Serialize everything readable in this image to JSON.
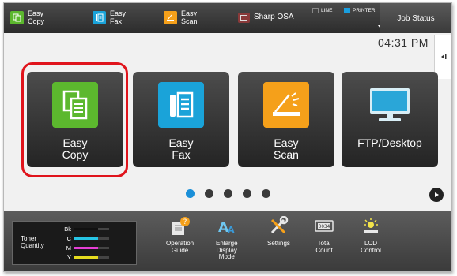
{
  "topbar": {
    "items": [
      {
        "label": "Easy\nCopy",
        "icon": "copy-icon"
      },
      {
        "label": "Easy\nFax",
        "icon": "fax-icon"
      },
      {
        "label": "Easy\nScan",
        "icon": "scan-icon"
      },
      {
        "label": "Sharp OSA",
        "icon": "osa-icon"
      }
    ],
    "indicators": {
      "line": "LINE",
      "printer": "PRINTER"
    },
    "job_status": "Job Status"
  },
  "clock": "04:31 PM",
  "tiles": [
    {
      "label": "Easy\nCopy",
      "icon": "copy-icon",
      "color": "#5cb82e"
    },
    {
      "label": "Easy\nFax",
      "icon": "fax-icon",
      "color": "#1aa3d9"
    },
    {
      "label": "Easy\nScan",
      "icon": "scan-icon",
      "color": "#f5a01a"
    },
    {
      "label": "FTP/Desktop",
      "icon": "monitor-icon",
      "color": "#2aa6d8"
    }
  ],
  "pager": {
    "pages": 5,
    "current": 1
  },
  "toner": {
    "title": "Toner\nQuantity",
    "rows": [
      {
        "label": "Bk",
        "color": "#222222"
      },
      {
        "label": "C",
        "color": "#27c6e6"
      },
      {
        "label": "M",
        "color": "#e63fd6"
      },
      {
        "label": "Y",
        "color": "#e6dc1f"
      }
    ]
  },
  "bottom_items": [
    {
      "label": "Operation\nGuide",
      "icon": "guide-icon"
    },
    {
      "label": "Enlarge\nDisplay\nMode",
      "icon": "enlarge-icon"
    },
    {
      "label": "Settings",
      "icon": "settings-icon"
    },
    {
      "label": "Total\nCount",
      "icon": "counter-icon"
    },
    {
      "label": "LCD\nControl",
      "icon": "brightness-icon"
    }
  ]
}
